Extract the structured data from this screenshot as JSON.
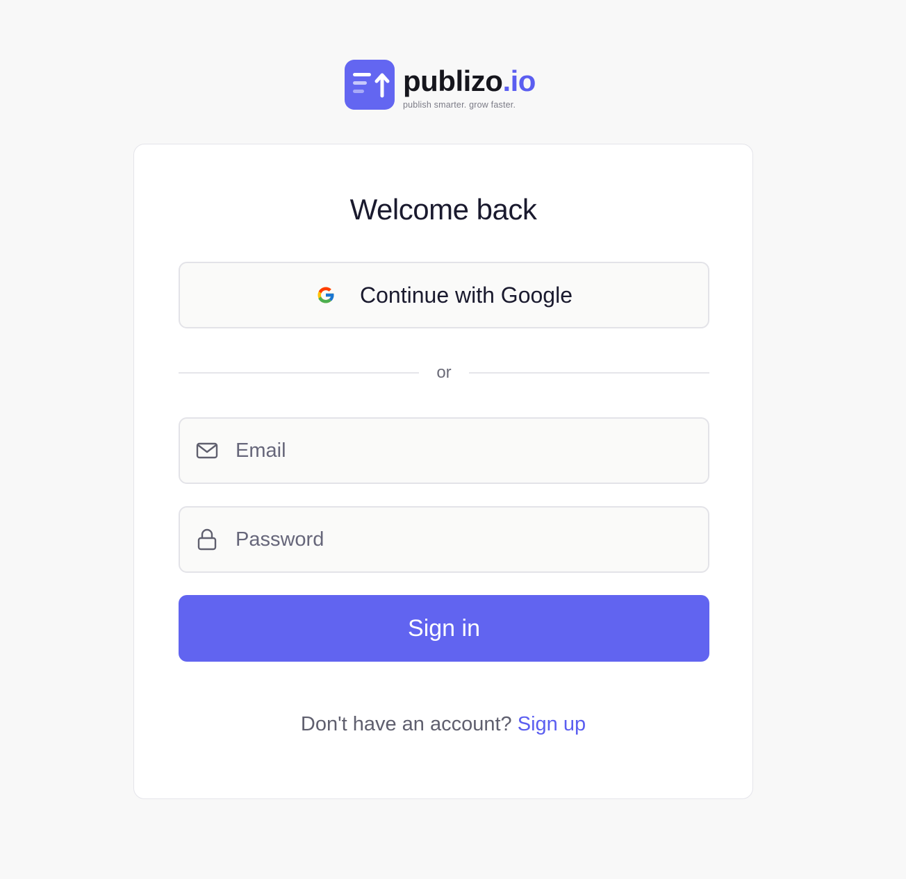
{
  "brand": {
    "name": "publizo",
    "tld": ".io",
    "tagline": "publish smarter. grow faster.",
    "logo_icon": "publish-arrow-icon"
  },
  "card": {
    "title": "Welcome back",
    "google_button": {
      "label": "Continue with Google",
      "icon": "google-icon"
    },
    "divider_text": "or",
    "email": {
      "placeholder": "Email",
      "value": "",
      "icon": "mail-icon"
    },
    "password": {
      "placeholder": "Password",
      "value": "",
      "icon": "lock-icon"
    },
    "signin_label": "Sign in",
    "footer": {
      "prompt": "Don't have an account?",
      "link_label": "Sign up"
    }
  },
  "colors": {
    "accent": "#6164f0",
    "link": "#5b5ef0",
    "background": "#f8f8f8",
    "card": "#ffffff"
  }
}
